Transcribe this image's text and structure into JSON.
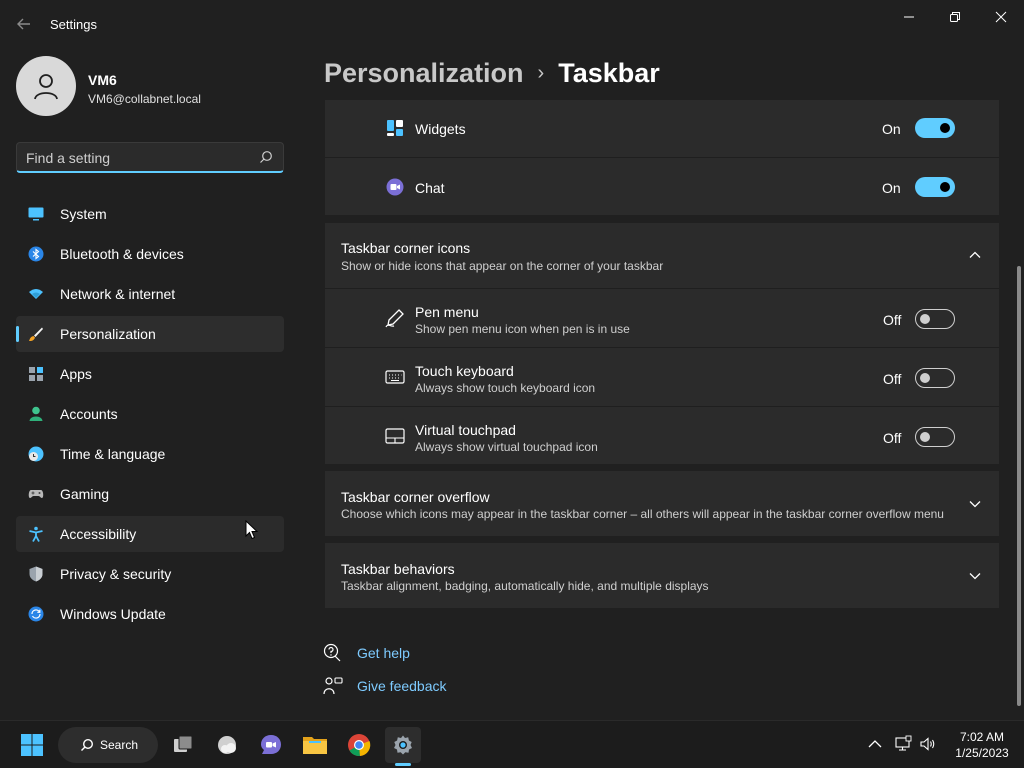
{
  "window": {
    "title": "Settings"
  },
  "profile": {
    "name": "VM6",
    "email": "VM6@collabnet.local"
  },
  "search": {
    "placeholder": "Find a setting",
    "value": ""
  },
  "nav": {
    "items": [
      {
        "label": "System",
        "icon": "monitor-icon"
      },
      {
        "label": "Bluetooth & devices",
        "icon": "bluetooth-icon"
      },
      {
        "label": "Network & internet",
        "icon": "wifi-icon"
      },
      {
        "label": "Personalization",
        "icon": "paintbrush-icon",
        "active": true
      },
      {
        "label": "Apps",
        "icon": "apps-icon"
      },
      {
        "label": "Accounts",
        "icon": "person-icon"
      },
      {
        "label": "Time & language",
        "icon": "clock-globe-icon"
      },
      {
        "label": "Gaming",
        "icon": "gamepad-icon"
      },
      {
        "label": "Accessibility",
        "icon": "accessibility-icon"
      },
      {
        "label": "Privacy & security",
        "icon": "shield-icon"
      },
      {
        "label": "Windows Update",
        "icon": "update-icon"
      }
    ]
  },
  "breadcrumb": {
    "parent": "Personalization",
    "separator": "›",
    "current": "Taskbar"
  },
  "taskbar_items": {
    "widgets": {
      "label": "Widgets",
      "state": "On",
      "enabled": true
    },
    "chat": {
      "label": "Chat",
      "state": "On",
      "enabled": true
    }
  },
  "corner_icons": {
    "title": "Taskbar corner icons",
    "subtitle": "Show or hide icons that appear on the corner of your taskbar",
    "expanded": true,
    "items": [
      {
        "label": "Pen menu",
        "description": "Show pen menu icon when pen is in use",
        "state": "Off",
        "enabled": false
      },
      {
        "label": "Touch keyboard",
        "description": "Always show touch keyboard icon",
        "state": "Off",
        "enabled": false
      },
      {
        "label": "Virtual touchpad",
        "description": "Always show virtual touchpad icon",
        "state": "Off",
        "enabled": false
      }
    ]
  },
  "corner_overflow": {
    "title": "Taskbar corner overflow",
    "subtitle": "Choose which icons may appear in the taskbar corner – all others will appear in the taskbar corner overflow menu"
  },
  "behaviors": {
    "title": "Taskbar behaviors",
    "subtitle": "Taskbar alignment, badging, automatically hide, and multiple displays"
  },
  "help": {
    "get_help": "Get help",
    "give_feedback": "Give feedback"
  },
  "system_taskbar": {
    "search_label": "Search",
    "time": "7:02 AM",
    "date": "1/25/2023"
  },
  "colors": {
    "accent": "#60cdff",
    "background": "#202020",
    "card": "#2b2b2b",
    "link": "#7ecbff"
  }
}
